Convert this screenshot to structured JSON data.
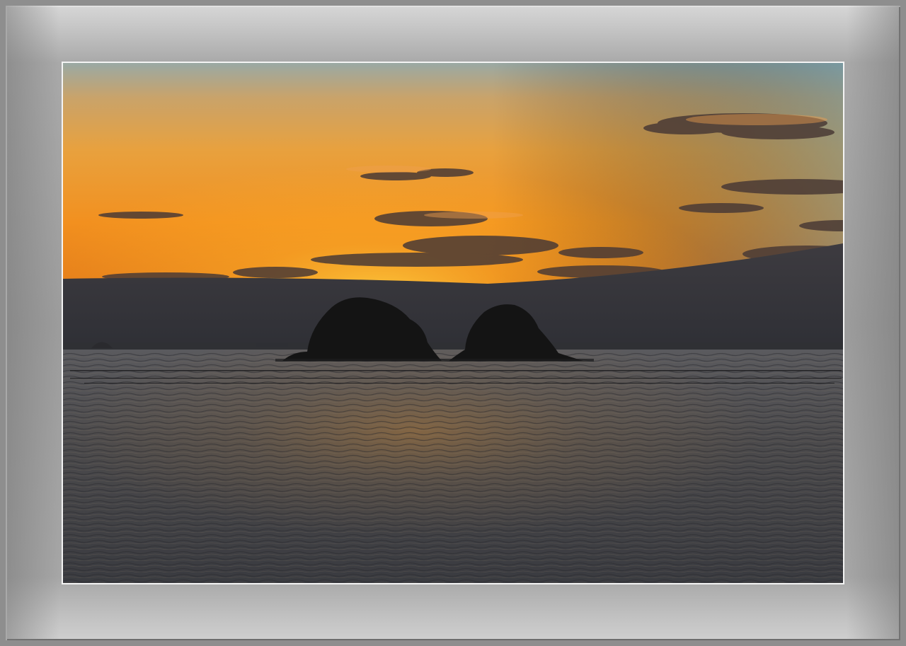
{
  "frame": {
    "outer_color": "#8e8e8e",
    "mat_color": "#f4f4f4"
  },
  "photo": {
    "subject": "sunset-over-sea-with-two-islands",
    "sky_colors": [
      "#7e9ca6",
      "#e8a43a",
      "#f08c1c",
      "#ffb428",
      "#3a3a40"
    ],
    "water_color": "#4a4a4e",
    "island_color": "#141414"
  }
}
